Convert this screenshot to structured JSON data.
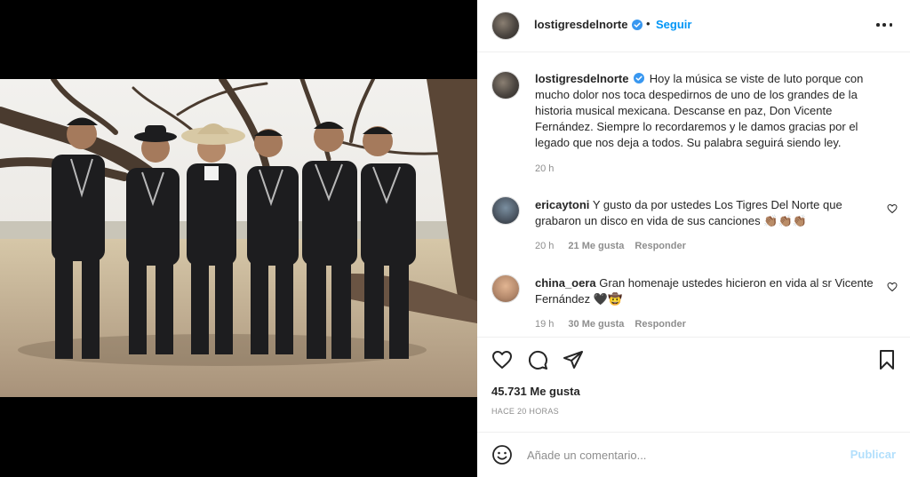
{
  "post": {
    "username": "lostigresdelnorte",
    "follow_label": "Seguir",
    "dot": "•",
    "caption": "Hoy la música se viste de luto porque con mucho dolor nos toca despedirnos de uno de los grandes de la historia musical mexicana. Descanse en paz, Don Vicente Fernández. Siempre lo recordaremos y le damos gracias por el legado que nos deja a todos. Su palabra seguirá siendo ley.",
    "caption_time": "20 h",
    "likes": "45.731 Me gusta",
    "posted_ago": "Hace 20 horas"
  },
  "comments": [
    {
      "username": "ericaytoni",
      "text": "Y gusto da por ustedes Los Tigres Del Norte que grabaron un disco en vida de sus canciones 👏🏽👏🏽👏🏽",
      "time": "20 h",
      "likes": "21 Me gusta",
      "reply": "Responder"
    },
    {
      "username": "china_oera",
      "text": "Gran homenaje ustedes hicieron en vida al sr Vicente Fernández 🖤🤠",
      "time": "19 h",
      "likes": "30 Me gusta",
      "reply": "Responder"
    }
  ],
  "composer": {
    "placeholder": "Añade un comentario...",
    "publish_label": "Publicar"
  },
  "icons": {
    "verified": "verified-badge-icon",
    "more": "more-options-icon",
    "like": "heart-icon",
    "comment": "comment-icon",
    "share": "share-icon",
    "save": "bookmark-icon",
    "emoji": "emoji-icon"
  },
  "colors": {
    "accent": "#0095f6",
    "muted": "#8e8e8e",
    "publish_disabled": "#b2dffc",
    "verified": "#3897f0"
  }
}
